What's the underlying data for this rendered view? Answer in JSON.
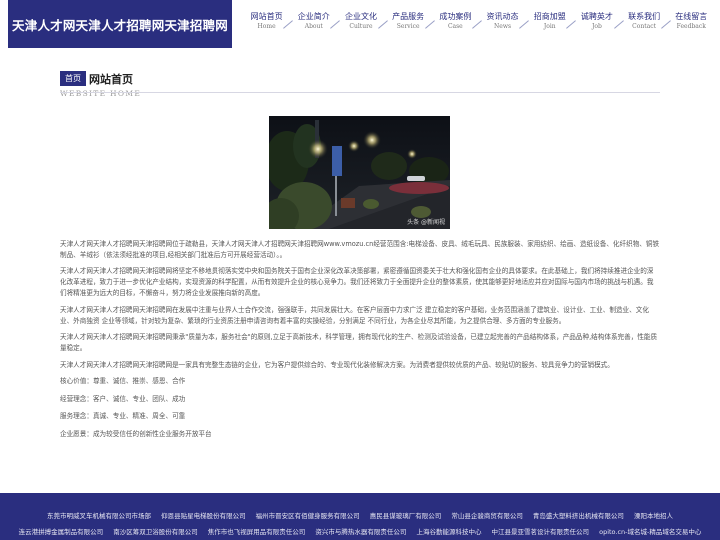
{
  "header": {
    "logo": "天津人才网天津人才招聘网天津招聘网",
    "nav": [
      {
        "cn": "网站首页",
        "en": "Home"
      },
      {
        "cn": "企业简介",
        "en": "About"
      },
      {
        "cn": "企业文化",
        "en": "Culture"
      },
      {
        "cn": "产品服务",
        "en": "Service"
      },
      {
        "cn": "成功案例",
        "en": "Case"
      },
      {
        "cn": "资讯动态",
        "en": "News"
      },
      {
        "cn": "招商加盟",
        "en": "Join"
      },
      {
        "cn": "诚聘英才",
        "en": "Job"
      },
      {
        "cn": "联系我们",
        "en": "Contact"
      },
      {
        "cn": "在线留言",
        "en": "Feedback"
      }
    ]
  },
  "section": {
    "badge": "首页",
    "title": "网站首页",
    "subtitle": "WEBSITE HOME"
  },
  "photo": {
    "watermark": "头条 @新闻视"
  },
  "content": {
    "paragraphs": [
      "天津人才网天津人才招聘网天津招聘网位于疏勒县，天津人才网天津人才招聘网天津招聘网www.vmozu.cn经营范围含:电梯设备、皮具、绒毛玩具、民族服装、家用纺织、绘画、造纸设备、化纤织物、铜铁制品、羊绒衫（依法须经批准的项目,经相关部门批准后方可开展经营活动）。。",
      "天津人才网天津人才招聘网天津招聘网将坚定不移地贯彻落实党中央和国务院关于国有企业深化改革决策部署，紧密遵循国资委关于壮大和强化国有企业的具体要求。在此基础上，我们将持续推进企业的深化改革进程，致力于进一步优化产业结构，实现资源的科学配置，从而有效提升企业的核心竞争力。我们还将致力于全面提升企业的整体素质，使其能够更好地适应并应对国际与国内市场的挑战与机遇。我们将精准更为远大的目标，不懈奋斗，努力将企业发展推向新的高度。",
      "天津人才网天津人才招聘网天津招聘网在发展中注重与业界人士合作交流，强强联手，共同发展壮大。在客户层面中力求广泛 建立稳定的客户基础，业务范围涵盖了建筑业、设计业、工业、制造业、文化业、外商独资 企业等领域，针对较为复杂、繁琐的行业资质注册申请咨询有着丰富的实操经验，分别满足 不同行业，为各企业尽其所能，为之提供合理、多方面的专业服务。",
      "天津人才网天津人才招聘网天津招聘网秉承\"质量为本，服务社会\"的原则,立足于高新技术，科学管理，拥有现代化的生产、检测及试验设备，已建立起完善的产品结构体系，产品品种,结构体系完善，性能质量稳定。",
      "天津人才网天津人才招聘网天津招聘网是一家具有完整生态链的企业，它为客户提供综合的、专业现代化装修解决方案。为消费者提供较优质的产品、较贴切的服务、较具竞争力的营销模式。"
    ],
    "values": [
      {
        "label": "核心价值：",
        "text": "尊重、诚信、推崇、感恩、合作"
      },
      {
        "label": "经营理念：",
        "text": "客户、诚信、专业、团队、成功"
      },
      {
        "label": "服务理念：",
        "text": "真诚、专业、精准、周全、可靠"
      },
      {
        "label": "企业愿景：",
        "text": "成为较受信任的创新性企业服务开放平台"
      }
    ]
  },
  "footer": {
    "row1": [
      "东莞市明威叉车机械有限公司市场部",
      "仰恩县贴星电梯股份有限公司",
      "福州市晋安区有佰健身服务有限公司",
      "惠民县谋玻璃厂有限公司",
      "常山县企骏商贸有限公司",
      "青岛盛大塑料挤出机械有限公司",
      "溧阳本地招人"
    ],
    "row2": [
      "连云港拼搏金属制品有限公司",
      "南沙区筹双卫浴股份有限公司",
      "焦作市也飞视屏用品有限责任公司",
      "资兴市与腾热水器有限责任公司",
      "上海谷勤能源科技中心",
      "中江县景亚雪茗设计有限责任公司",
      "opito.cn-域名城-精品域名交易中心"
    ]
  },
  "colors": {
    "brand": "#2a2e7f",
    "text": "#555555"
  }
}
